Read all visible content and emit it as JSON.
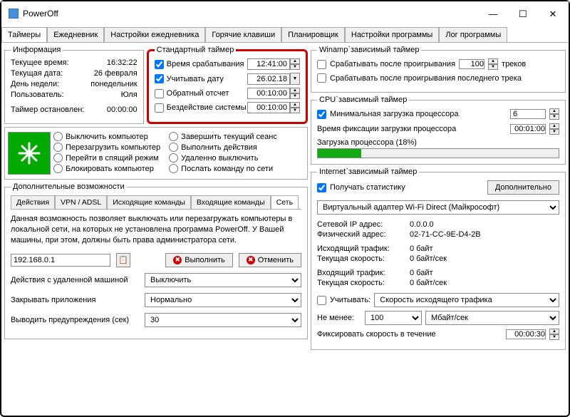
{
  "window": {
    "title": "PowerOff"
  },
  "tabs": {
    "items": [
      "Таймеры",
      "Ежедневник",
      "Настройки ежедневника",
      "Горячие клавиши",
      "Планировщик",
      "Настройки программы",
      "Лог программы"
    ],
    "activeIndex": 0
  },
  "info": {
    "legend": "Информация",
    "rows": [
      {
        "label": "Текущее время:",
        "value": "16:32:22"
      },
      {
        "label": "Текущая дата:",
        "value": "26 февраля"
      },
      {
        "label": "День недели:",
        "value": "понедельник"
      },
      {
        "label": "Пользователь:",
        "value": "Юля"
      }
    ],
    "timerStopped": {
      "label": "Таймер остановлен:",
      "value": "00:00:00"
    }
  },
  "stdTimer": {
    "legend": "Стандартный таймер",
    "triggerTimeLabel": "Время срабатывания",
    "triggerTimeValue": "12:41:00",
    "triggerTimeChecked": true,
    "dateLabel": "Учитывать дату",
    "dateValue": "26.02.18",
    "dateChecked": true,
    "countdownLabel": "Обратный отсчет",
    "countdownValue": "00:10:00",
    "countdownChecked": false,
    "idleLabel": "Бездействие системы",
    "idleValue": "00:10:00",
    "idleChecked": false
  },
  "actions": {
    "col1": [
      "Выключить компьютер",
      "Перезагрузить компьютер",
      "Перейти в спящий режим",
      "Блокировать компьютер"
    ],
    "col2": [
      "Завершить текущий сеанс",
      "Выполнить действия",
      "Удаленно выключить",
      "Послать команду по сети"
    ]
  },
  "extra": {
    "legend": "Дополнительные возможности",
    "subtabs": [
      "Действия",
      "VPN / ADSL",
      "Исходящие команды",
      "Входящие команды",
      "Сеть"
    ],
    "subtabActive": 4,
    "desc": "Данная возможность позволяет выключать или перезагружать компьютеры в локальной сети, на которых не установлена программа PowerOff. У Вашей машины, при этом, должны быть права администратора сети.",
    "ip": "192.168.0.1",
    "execute": "Выполнить",
    "cancel": "Отменить",
    "remoteActionLabel": "Действия с удаленной машиной",
    "remoteActionValue": "Выключить",
    "closeAppsLabel": "Закрывать приложения",
    "closeAppsValue": "Нормально",
    "warnLabel": "Выводить предупреждения (сек)",
    "warnValue": "30"
  },
  "winamp": {
    "legend": "Winamp`зависимый таймер",
    "afterPlay": "Срабатывать после проигрывания",
    "tracks": "100",
    "tracksLabel": "треков",
    "afterLast": "Срабатывать после проигрывания последнего трека"
  },
  "cpu": {
    "legend": "CPU`зависимый таймер",
    "minLoad": "Минимальная загрузка процессора",
    "minLoadVal": "6",
    "fixTime": "Время фиксации загрузки процессора",
    "fixTimeVal": "00:01:00",
    "load": "Загрузка процессора (18%)",
    "loadPct": 18
  },
  "inet": {
    "legend": "Internet`зависимый таймер",
    "getStats": "Получать статистику",
    "advanced": "Дополнительно",
    "adapter": "Виртуальный адаптер Wi-Fi Direct (Майкрософт)",
    "ipLabel": "Сетевой IP адрес:",
    "ipVal": "0.0.0.0",
    "macLabel": "Физический адрес:",
    "macVal": "02-71-CC-9E-D4-2B",
    "outLabel": "Исходящий трафик:",
    "outVal": "0 байт",
    "outSpeedLabel": "Текущая скорость:",
    "outSpeedVal": "0 байт/сек",
    "inLabel": "Входящий трафик:",
    "inVal": "0 байт",
    "inSpeedLabel": "Текущая скорость:",
    "inSpeedVal": "0 байт/сек",
    "consider": "Учитывать:",
    "considerVal": "Скорость исходящего трафика",
    "atLeast": "Не менее:",
    "atLeastVal": "100",
    "atLeastUnit": "Мбайт/сек",
    "fixSpeed": "Фиксировать скорость в течение",
    "fixSpeedVal": "00:00:30"
  }
}
